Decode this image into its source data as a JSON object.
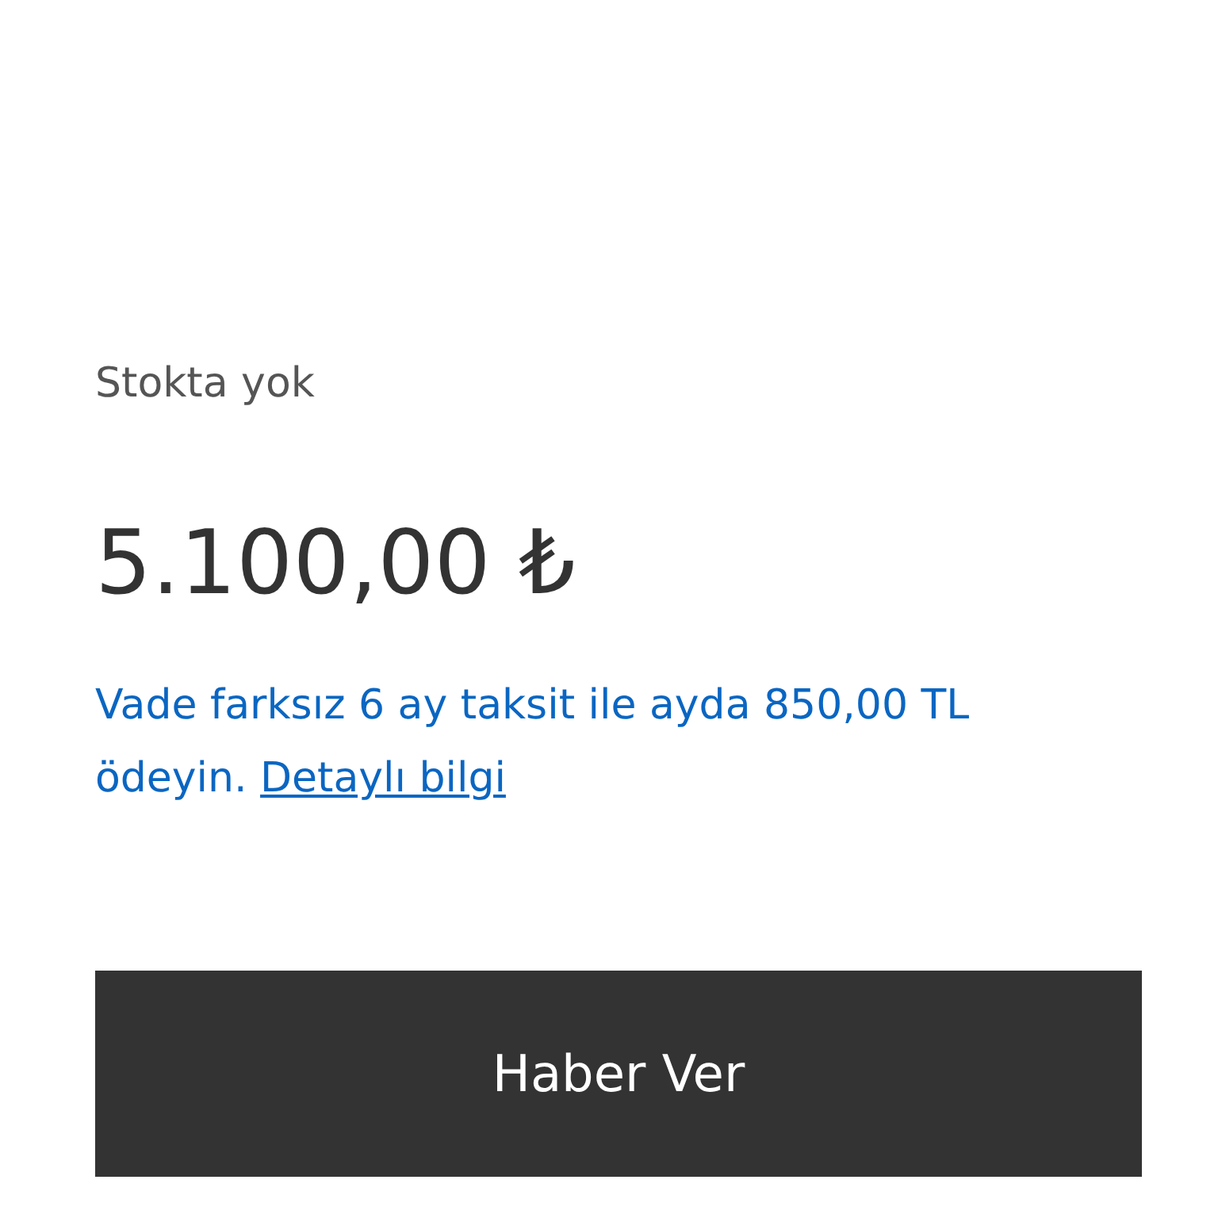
{
  "stock_status": "Stokta yok",
  "price": "5.100,00 ₺",
  "installment": {
    "text": "Vade farksız 6 ay taksit ile ayda 850,00 TL ödeyin.",
    "link": "Detaylı bilgi"
  },
  "button": {
    "label": "Haber Ver"
  }
}
